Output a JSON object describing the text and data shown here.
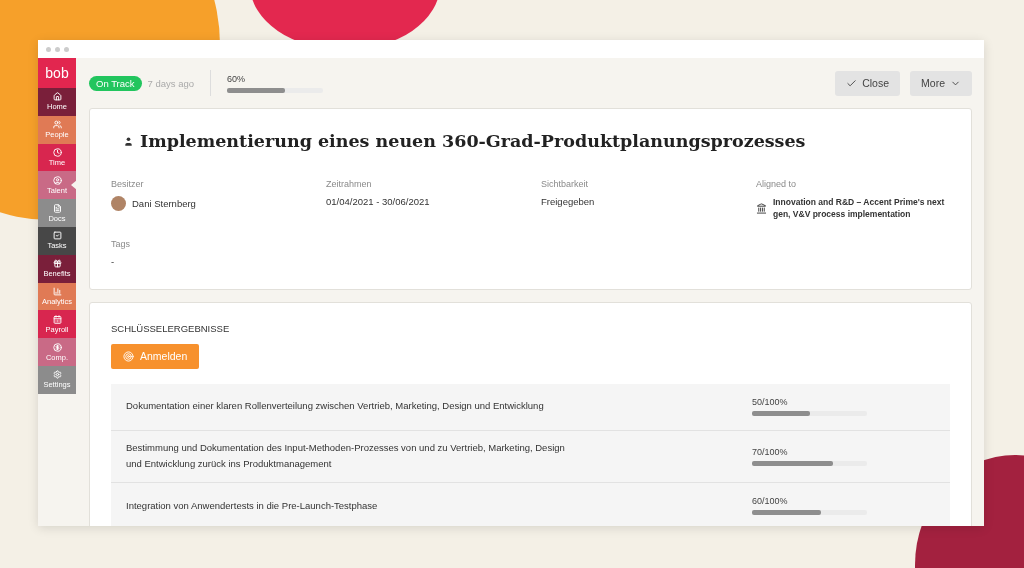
{
  "logo": "bob",
  "sidebar": {
    "items": [
      {
        "label": "Home",
        "color": "#7a1f3a",
        "selected": false
      },
      {
        "label": "People",
        "color": "#e07a55",
        "selected": false
      },
      {
        "label": "Time",
        "color": "#d8264f",
        "selected": false
      },
      {
        "label": "Talent",
        "color": "#c96a86",
        "selected": true
      },
      {
        "label": "Docs",
        "color": "#8c8c8c",
        "selected": false
      },
      {
        "label": "Tasks",
        "color": "#474747",
        "selected": false
      },
      {
        "label": "Benefits",
        "color": "#7a1f3a",
        "selected": false
      },
      {
        "label": "Analytics",
        "color": "#e07a55",
        "selected": false
      },
      {
        "label": "Payroll",
        "color": "#d8264f",
        "selected": false
      },
      {
        "label": "Comp.",
        "color": "#c96a86",
        "selected": false
      },
      {
        "label": "Settings",
        "color": "#8c8c8c",
        "selected": false
      }
    ]
  },
  "header": {
    "status": "On Track",
    "updated": "7 days ago",
    "progress_label": "60%",
    "level": 0.6,
    "buttons": [
      {
        "label": "Close"
      },
      {
        "label": "More"
      }
    ]
  },
  "goal": {
    "title": "Implementierung eines neuen 360-Grad-Produktplanungsprozesses",
    "fields": [
      {
        "label": "Besitzer",
        "value": "Dani Sternberg",
        "kind": "person"
      },
      {
        "label": "Zeitrahmen",
        "value": "01/04/2021 - 30/06/2021",
        "kind": "text"
      },
      {
        "label": "Sichtbarkeit",
        "value": "Freigegeben",
        "kind": "text"
      },
      {
        "label": "Aligned to",
        "value": "Innovation and R&D – Accent Prime's next gen, V&V process implementation",
        "kind": "link"
      }
    ],
    "tags_label": "Tags",
    "tags_value": "-"
  },
  "key_results": {
    "heading": "SCHLÜSSELERGEBNISSE",
    "button": "Anmelden",
    "rows": [
      {
        "text": "Dokumentation einer klaren Rollenverteilung zwischen Vertrieb, Marketing, Design und Entwicklung",
        "reading": "50/100%",
        "level": 0.5
      },
      {
        "text": "Bestimmung und Dokumentation des Input-Methoden-Prozesses von und zu Vertrieb, Marketing, Design und Entwicklung zurück ins Produktmanagement",
        "reading": "70/100%",
        "level": 0.7
      },
      {
        "text": "Integration von Anwendertests in die Pre-Launch-Testphase",
        "reading": "60/100%",
        "level": 0.6
      }
    ]
  }
}
